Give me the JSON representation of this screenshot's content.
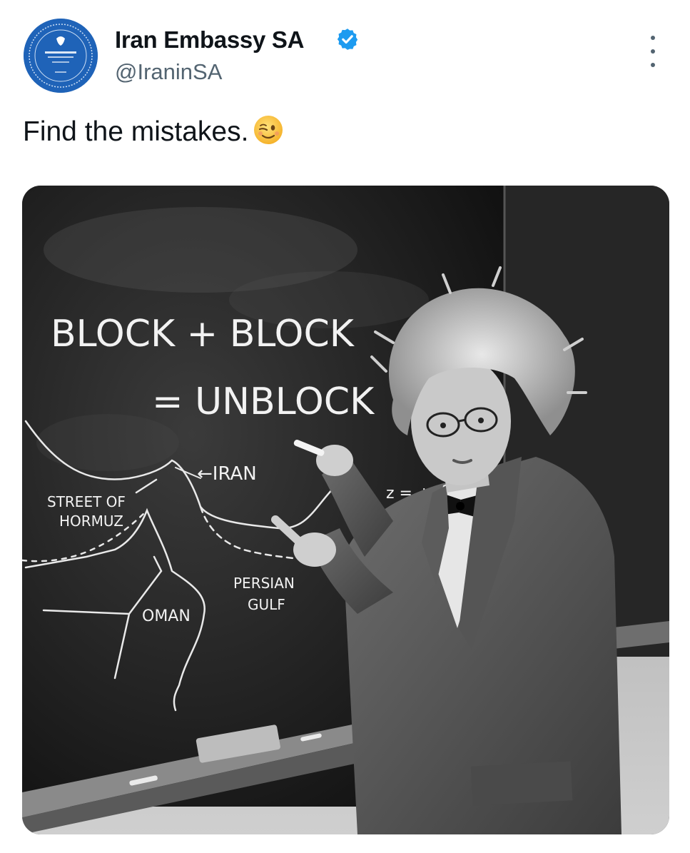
{
  "post": {
    "author": {
      "display_name": "Iran Embassy SA",
      "handle": "@IraninSA",
      "verified": true,
      "avatar_icon": "embassy-seal-icon",
      "avatar_color": "#1f63b8"
    },
    "text": "Find the mistakes.",
    "emoji": "winking-face-icon",
    "menu_icon": "more-options-icon",
    "verified_color": "#1d9bf0"
  },
  "media": {
    "type": "photo",
    "chalk_text": {
      "line1": "BLOCK + BLOCK",
      "line2": "= UNBLOCK",
      "iran": "←IRAN",
      "street1": "STREET OF",
      "street2": "HORMUZ",
      "oman": "OMAN",
      "persian": "PERSIAN",
      "gulf": "GULF",
      "equation": "z = +"
    }
  }
}
